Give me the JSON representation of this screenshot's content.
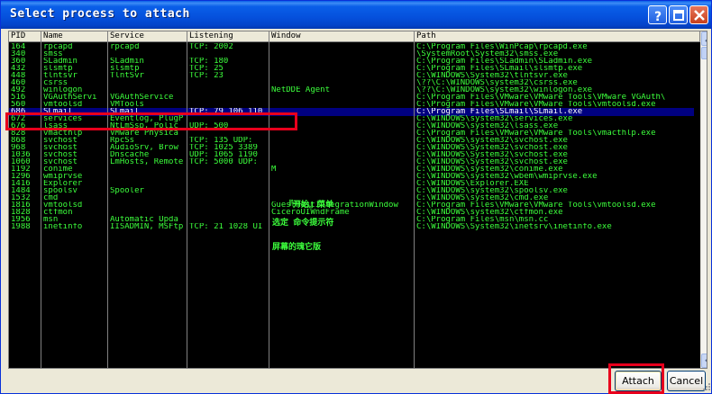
{
  "window": {
    "title": "Select process to attach"
  },
  "columns": [
    {
      "key": "pid",
      "label": "PID"
    },
    {
      "key": "name",
      "label": "Name"
    },
    {
      "key": "service",
      "label": "Service"
    },
    {
      "key": "listening",
      "label": "Listening"
    },
    {
      "key": "window",
      "label": "Window"
    },
    {
      "key": "path",
      "label": "Path"
    }
  ],
  "rows": [
    {
      "pid": "164",
      "name": "rpcapd",
      "service": "rpcapd",
      "listening": "TCP: 2002",
      "window": "",
      "path": "C:\\Program Files\\WinPcap\\rpcapd.exe"
    },
    {
      "pid": "340",
      "name": "smss",
      "service": "",
      "listening": "",
      "window": "",
      "path": "\\SystemRoot\\System32\\smss.exe"
    },
    {
      "pid": "360",
      "name": "SLadmin",
      "service": "SLadmin",
      "listening": "TCP: 180",
      "window": "",
      "path": "C:\\Program Files\\SLadmin\\SLadmin.exe"
    },
    {
      "pid": "432",
      "name": "slsmtp",
      "service": "slsmtp",
      "listening": "TCP: 25",
      "window": "",
      "path": "C:\\Program Files\\SLmail\\slsmtp.exe"
    },
    {
      "pid": "448",
      "name": "tlntsvr",
      "service": "TlntSvr",
      "listening": "TCP: 23",
      "window": "",
      "path": "C:\\WINDOWS\\System32\\tlntsvr.exe"
    },
    {
      "pid": "460",
      "name": "csrss",
      "service": "",
      "listening": "",
      "window": "",
      "path": "\\??\\C:\\WINDOWS\\system32\\csrss.exe"
    },
    {
      "pid": "492",
      "name": "winlogon",
      "service": "",
      "listening": "",
      "window": "NetDDE Agent",
      "path": "\\??\\C:\\WINDOWS\\system32\\winlogon.exe"
    },
    {
      "pid": "516",
      "name": "VGAuthServi",
      "service": "VGAuthService",
      "listening": "",
      "window": "",
      "path": "C:\\Program Files\\VMware\\VMware Tools\\VMware VGAuth\\"
    },
    {
      "pid": "560",
      "name": "vmtoolsd",
      "service": "VMTools",
      "listening": "",
      "window": "",
      "path": "C:\\Program Files\\VMware\\VMware Tools\\vmtoolsd.exe"
    },
    {
      "pid": "686",
      "name": "SLmail",
      "service": "SLmail",
      "listening": "TCP: 79 106 110",
      "window": "",
      "path": "C:\\Program Files\\SLmail\\SLmail.exe",
      "selected": true
    },
    {
      "pid": "672",
      "name": "services",
      "service": "Eventlog, PlugP",
      "listening": "",
      "window": "",
      "path": "C:\\WINDOWS\\system32\\services.exe"
    },
    {
      "pid": "676",
      "name": "lsass",
      "service": "NtLmSsp, Polic",
      "listening": "UDP: 500",
      "window": "",
      "path": "C:\\WINDOWS\\system32\\lsass.exe"
    },
    {
      "pid": "828",
      "name": "vmacthlp",
      "service": "VMware Physica",
      "listening": "",
      "window": "",
      "path": "C:\\Program Files\\VMware\\VMware Tools\\vmacthlp.exe"
    },
    {
      "pid": "868",
      "name": "svchost",
      "service": "RpcSs",
      "listening": "TCP: 135 UDP:",
      "window": "",
      "path": "C:\\WINDOWS\\system32\\svchost.exe"
    },
    {
      "pid": "968",
      "name": "svchost",
      "service": "AudioSrv, Brow",
      "listening": "TCP: 1025 3389",
      "window": "",
      "path": "C:\\WINDOWS\\System32\\svchost.exe"
    },
    {
      "pid": "1036",
      "name": "svchost",
      "service": "Dnscache",
      "listening": "UDP: 1065 1190",
      "window": "",
      "path": "C:\\WINDOWS\\System32\\svchost.exe"
    },
    {
      "pid": "1060",
      "name": "svchost",
      "service": "LmHosts, Remote",
      "listening": "TCP: 5000 UDP:",
      "window": "",
      "path": "C:\\WINDOWS\\System32\\svchost.exe"
    },
    {
      "pid": "1192",
      "name": "conime",
      "service": "",
      "listening": "",
      "window": "M",
      "path": "C:\\WINDOWS\\system32\\conime.exe"
    },
    {
      "pid": "1296",
      "name": "wmiprvse",
      "service": "",
      "listening": "",
      "window": "",
      "path": "C:\\WINDOWS\\system32\\wbem\\wmiprvse.exe"
    },
    {
      "pid": "1416",
      "name": "Explorer",
      "service": "",
      "listening": "",
      "window": "",
      "path": "C:\\WINDOWS\\Explorer.EXE"
    },
    {
      "pid": "1484",
      "name": "spoolsv",
      "service": "Spooler",
      "listening": "",
      "window": "",
      "path": "C:\\WINDOWS\\system32\\spoolsv.exe"
    },
    {
      "pid": "1532",
      "name": "cmd",
      "service": "",
      "listening": "",
      "window": "",
      "path": "C:\\WINDOWS\\system32\\cmd.exe"
    },
    {
      "pid": "1816",
      "name": "vmtoolsd",
      "service": "",
      "listening": "",
      "window": "GuestHostIntegrationWindow",
      "path": "C:\\Program Files\\VMware\\VMware Tools\\vmtoolsd.exe"
    },
    {
      "pid": "1828",
      "name": "ctfmon",
      "service": "",
      "listening": "",
      "window": "CiceroUIWndFrame",
      "path": "C:\\WINDOWS\\system32\\ctfmon.exe"
    },
    {
      "pid": "1956",
      "name": "msn",
      "service": "Automatic Upda",
      "listening": "",
      "window": "",
      "path": "C:\\Program Files\\msn\\msn.cc"
    },
    {
      "pid": "1988",
      "name": "inetinfo",
      "service": "IISADMIN, MSFtp",
      "listening": "TCP: 21 1028 UI",
      "window": "",
      "path": "C:\\WINDOWS\\System32\\inetsrv\\inetinfo.exe"
    }
  ],
  "window_column_extra": [
    {
      "text": "『开始』菜单"
    },
    {
      "text": "选定 命令提示符"
    },
    {
      "text": "屏幕的瑰它版"
    }
  ],
  "buttons": {
    "attach": "Attach",
    "cancel": "Cancel"
  },
  "colors": {
    "text": "#3cff3c",
    "selection": "#000080",
    "highlight": "#e8001c"
  }
}
